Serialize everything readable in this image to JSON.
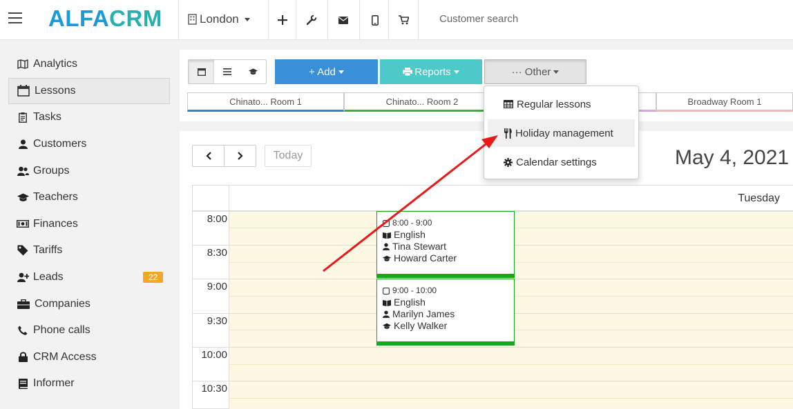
{
  "app": {
    "logo_part1": "ALFA",
    "logo_part2": "CRM",
    "branch": "London",
    "search_placeholder": "Customer search"
  },
  "toolbar_icons": [
    "plus-icon",
    "wrench-icon",
    "envelope-icon",
    "mobile-icon",
    "cart-icon"
  ],
  "sidebar": {
    "items": [
      {
        "label": "Analytics",
        "icon": "map-icon"
      },
      {
        "label": "Lessons",
        "icon": "calendar-icon",
        "active": true
      },
      {
        "label": "Tasks",
        "icon": "clipboard-icon"
      },
      {
        "label": "Customers",
        "icon": "user-icon"
      },
      {
        "label": "Groups",
        "icon": "users-icon"
      },
      {
        "label": "Teachers",
        "icon": "graduation-cap-icon"
      },
      {
        "label": "Finances",
        "icon": "money-icon"
      },
      {
        "label": "Tariffs",
        "icon": "tag-icon"
      },
      {
        "label": "Leads",
        "icon": "user-plus-icon",
        "badge": "22"
      },
      {
        "label": "Companies",
        "icon": "briefcase-icon"
      },
      {
        "label": "Phone calls",
        "icon": "phone-icon"
      },
      {
        "label": "CRM Access",
        "icon": "lock-icon"
      },
      {
        "label": "Informer",
        "icon": "book-icon"
      }
    ]
  },
  "actions": {
    "add_label": "+ Add",
    "reports_label": "Reports",
    "other_label": "··· Other"
  },
  "rooms": [
    {
      "label": "Chinato... Room 1",
      "color": "#3a7fc1"
    },
    {
      "label": "Chinato... Room 2",
      "color": "#3cb043"
    },
    {
      "label": "",
      "color": "#d9a7e0"
    },
    {
      "label": "Broadway Room 1",
      "color": "#f2b8b8"
    }
  ],
  "dropdown": {
    "items": [
      {
        "label": "Regular lessons",
        "icon": "table-icon"
      },
      {
        "label": "Holiday management",
        "icon": "cutlery-icon",
        "highlighted": true
      },
      {
        "label": "Calendar settings",
        "icon": "cog-icon"
      }
    ]
  },
  "calendar": {
    "today_label": "Today",
    "date_title": "May 4, 2021",
    "day_name": "Tuesday",
    "times": [
      "8:00",
      "8:30",
      "9:00",
      "9:30",
      "10:00",
      "10:30"
    ],
    "events": [
      {
        "time": "8:00 - 9:00",
        "subject": "English",
        "student": "Tina Stewart",
        "teacher": "Howard Carter"
      },
      {
        "time": "9:00 - 10:00",
        "subject": "English",
        "student": "Marilyn James",
        "teacher": "Kelly Walker"
      }
    ]
  },
  "colors": {
    "accent_blue": "#3a8fd9",
    "accent_teal": "#4ec9c9",
    "event_green": "#1aa51a",
    "badge_orange": "#f5a623",
    "slot_bg": "#fcf8e3",
    "annotation_red": "#e8191a"
  }
}
